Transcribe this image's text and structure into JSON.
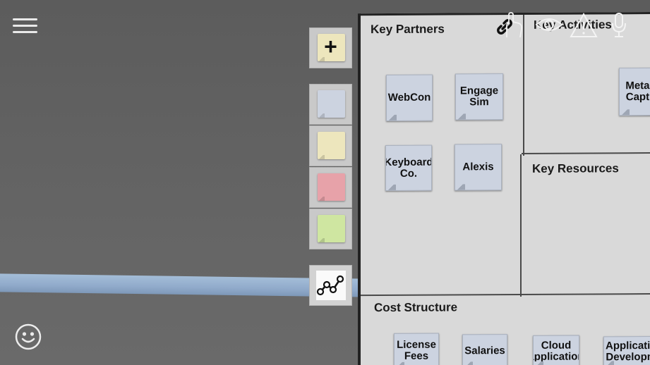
{
  "colors": {
    "note_blue": "#ccd3e0",
    "note_yellow": "#ede6bd",
    "note_red": "#e7a2a9",
    "note_green": "#cfe6a1"
  },
  "toolbar": {
    "add_label": "+",
    "colors": [
      {
        "name": "blue",
        "color": "#ccd3e0"
      },
      {
        "name": "yellow",
        "color": "#ede6bd"
      },
      {
        "name": "red",
        "color": "#e7a2a9"
      },
      {
        "name": "green",
        "color": "#cfe6a1"
      }
    ]
  },
  "board": {
    "sections": {
      "key_partners": "Key Partners",
      "key_activities": "Key Activities",
      "key_resources": "Key Resources",
      "cost_structure": "Cost Structure"
    },
    "notes": {
      "webcon": "WebCon",
      "engage_sim": "Engage Sim",
      "keyboard_co": "Keyboard Co.",
      "alexis": "Alexis",
      "metadata_capture": "Metad Captu",
      "license_fees": "License Fees",
      "salaries": "Salaries",
      "cloud_application": "Cloud application",
      "application_development": "Applicatio Developm"
    }
  }
}
